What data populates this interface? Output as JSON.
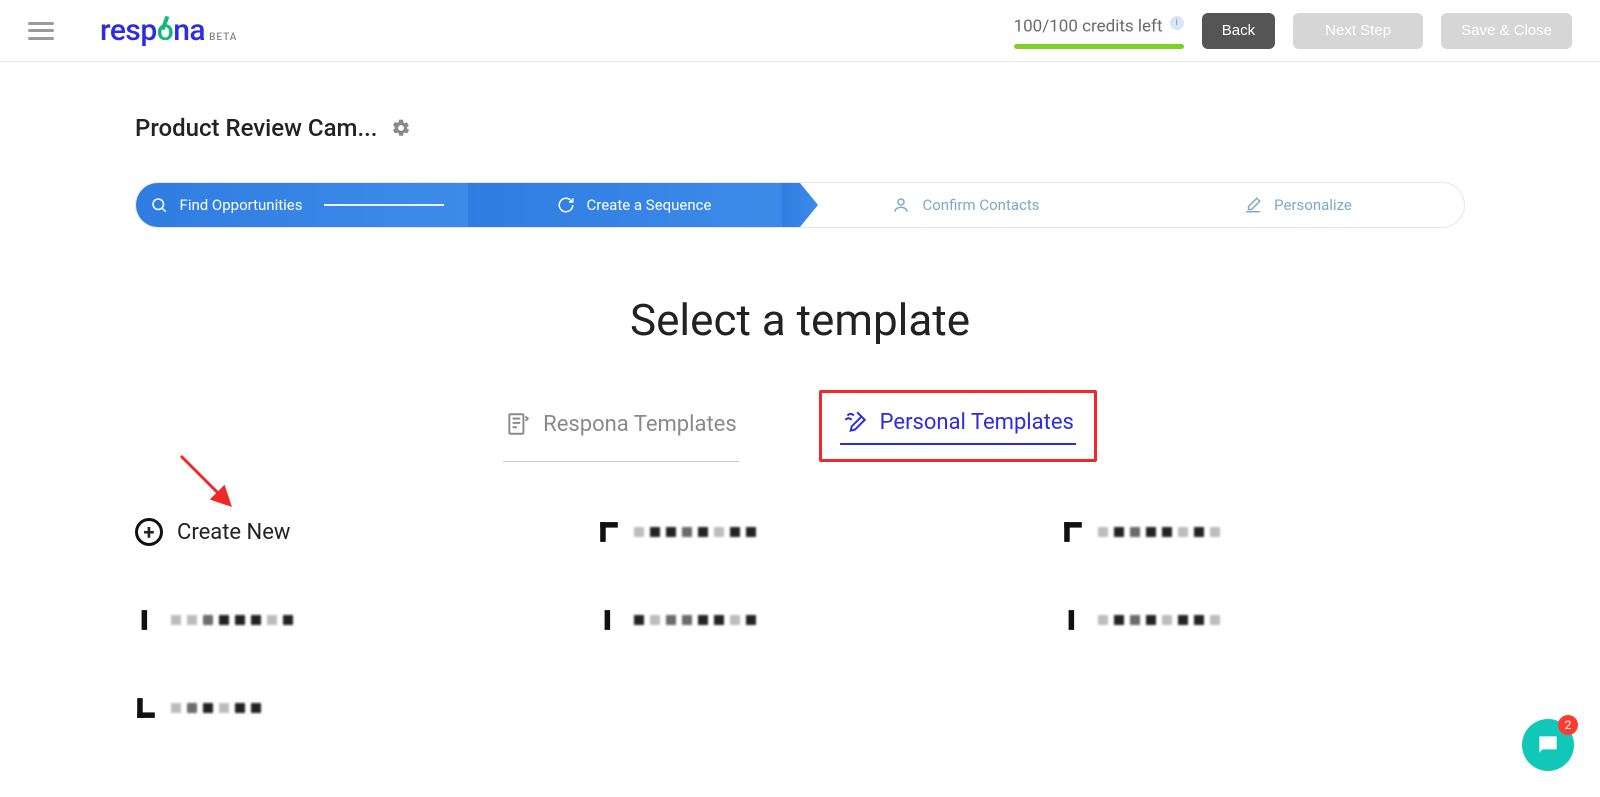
{
  "header": {
    "logo_text_a": "resp",
    "logo_text_b": "o",
    "logo_text_c": "na",
    "logo_sub": "BETA",
    "credits_label": "100/100 credits left",
    "info_badge": "i",
    "back_label": "Back",
    "next_label": "Next Step",
    "save_label": "Save & Close"
  },
  "campaign": {
    "title": "Product Review Cam..."
  },
  "stepper": {
    "step1": "Find Opportunities",
    "step2": "Create a Sequence",
    "step3": "Confirm Contacts",
    "step4": "Personalize"
  },
  "page": {
    "title": "Select a template"
  },
  "tabs": {
    "respona": "Respona Templates",
    "personal": "Personal Templates"
  },
  "templates": {
    "create_new": "Create New"
  },
  "chat": {
    "unread": "2"
  }
}
